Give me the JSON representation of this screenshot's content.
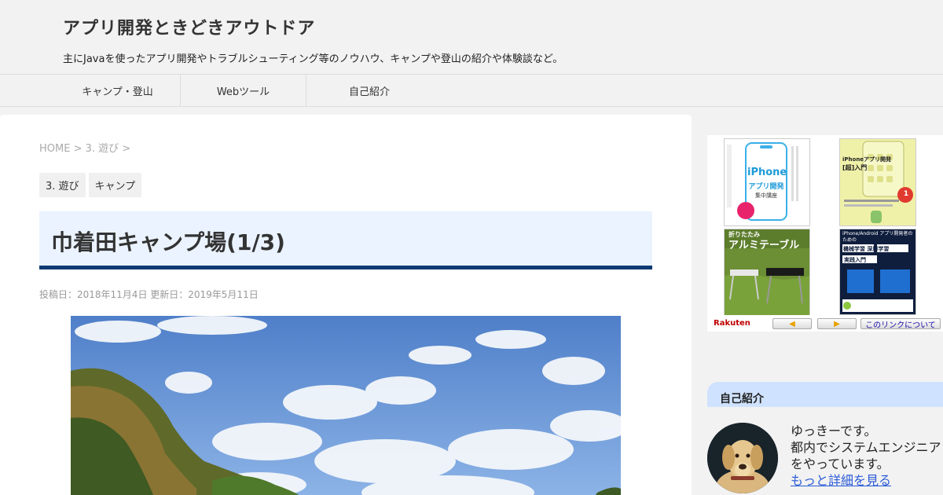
{
  "site": {
    "title": "アプリ開発ときどきアウトドア",
    "description": "主にJavaを使ったアプリ開発やトラブルシューティング等のノウハウ、キャンプや登山の紹介や体験談など。"
  },
  "nav": {
    "items": [
      {
        "label": "キャンプ・登山"
      },
      {
        "label": "Webツール"
      },
      {
        "label": "自己紹介"
      }
    ]
  },
  "breadcrumb": {
    "home": "HOME",
    "sep": " > ",
    "category": "3. 遊び",
    "tail": " >"
  },
  "categories": [
    "3. 遊び",
    "キャンプ"
  ],
  "article": {
    "title": "巾着田キャンプ場(1/3)",
    "dates": "投稿日：2018年11月4日 更新日：2019年5月11日"
  },
  "ad": {
    "books": [
      {
        "title": "iPhone",
        "subtitle": "アプリ開発",
        "tag": "集中講座"
      },
      {
        "title": "iPhoneアプリ開発",
        "subtitle": "[超]入門",
        "tag": "1"
      },
      {
        "title": "アルミテーブル",
        "subtitle": "折りたたみ"
      },
      {
        "title": "機械学習 深層学習",
        "subtitle": "iPhone/Android アプリ開発者のための",
        "tag": "実践入門"
      }
    ],
    "brand": "Rakuten",
    "prev_icon": "◀",
    "next_icon": "▶",
    "link_label": "このリンクについて"
  },
  "profile": {
    "heading": "自己紹介",
    "line1": "ゆっきーです。",
    "line2": "都内でシステムエンジニア",
    "line3": "をやっています。",
    "more": "もっと詳細を見る"
  },
  "colors": {
    "accent": "#0e3a73",
    "title_bg": "#eaf3ff",
    "sidebar_head": "#cfe2ff",
    "link": "#2b5bd7"
  }
}
